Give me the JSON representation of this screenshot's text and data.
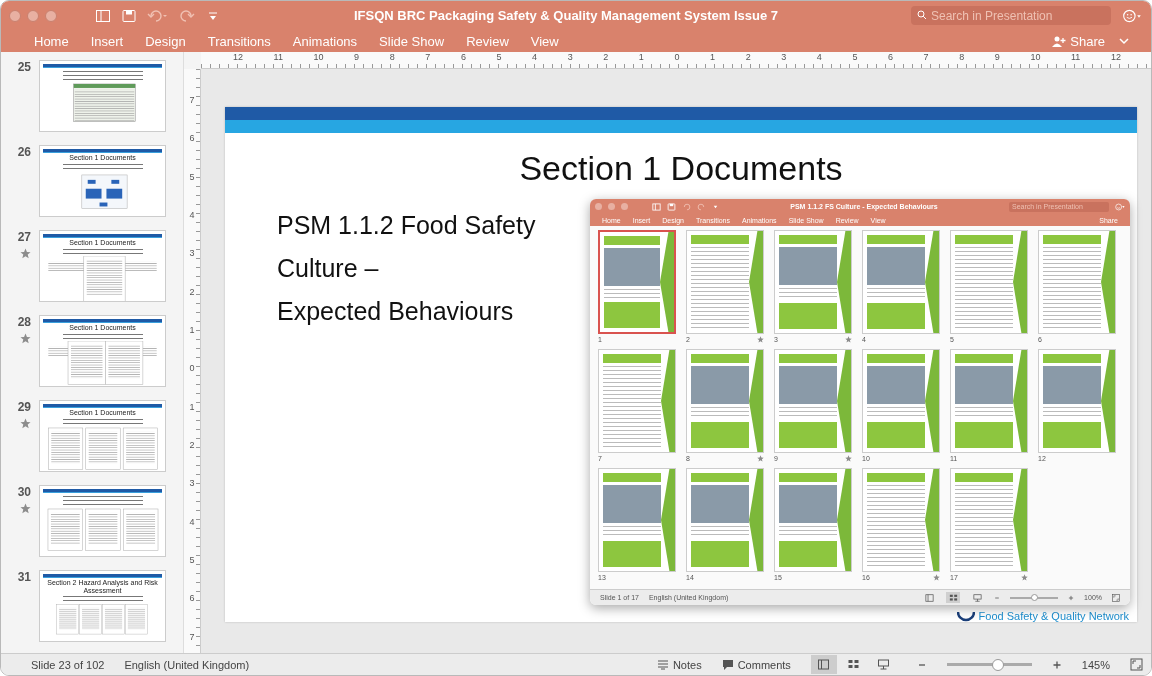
{
  "window": {
    "title": "IFSQN BRC Packaging Safety & Quality Management System Issue 7"
  },
  "search": {
    "placeholder": "Search in Presentation"
  },
  "tabs": [
    {
      "label": "Home"
    },
    {
      "label": "Insert"
    },
    {
      "label": "Design"
    },
    {
      "label": "Transitions"
    },
    {
      "label": "Animations"
    },
    {
      "label": "Slide Show"
    },
    {
      "label": "Review"
    },
    {
      "label": "View"
    }
  ],
  "share": "Share",
  "ruler": {
    "horizontal": [
      "12",
      "11",
      "10",
      "9",
      "8",
      "7",
      "6",
      "5",
      "4",
      "3",
      "2",
      "1",
      "0",
      "1",
      "2",
      "3",
      "4",
      "5",
      "6",
      "7",
      "8",
      "9",
      "10",
      "11",
      "12"
    ],
    "vertical": [
      "7",
      "6",
      "5",
      "4",
      "3",
      "2",
      "1",
      "0",
      "1",
      "2",
      "3",
      "4",
      "5",
      "6",
      "7"
    ]
  },
  "slides": [
    {
      "number": "25",
      "kind": "table",
      "starred": false
    },
    {
      "number": "26",
      "kind": "diagram",
      "starred": false,
      "title": "Section 1 Documents"
    },
    {
      "number": "27",
      "kind": "document",
      "starred": true,
      "title": "Section 1 Documents"
    },
    {
      "number": "28",
      "kind": "two-docs",
      "starred": true,
      "title": "Section 1 Documents"
    },
    {
      "number": "29",
      "kind": "three-docs",
      "starred": true,
      "title": "Section 1 Documents"
    },
    {
      "number": "30",
      "kind": "three-docs",
      "starred": true
    },
    {
      "number": "31",
      "kind": "four-docs",
      "starred": false,
      "title": "Section 2 Hazard Analysis and Risk Assessment"
    }
  ],
  "current_slide": {
    "title": "Section 1 Documents",
    "body": [
      "PSM 1.1.2 Food Safety",
      "Culture –",
      "Expected Behaviours"
    ],
    "logo": "Food Safety & Quality Network"
  },
  "embedded_window": {
    "title": "PSM 1.1.2 FS Culture - Expected Behaviours",
    "search": {
      "placeholder": "Search in Presentation"
    },
    "tabs": [
      {
        "label": "Home"
      },
      {
        "label": "Insert"
      },
      {
        "label": "Design"
      },
      {
        "label": "Transitions"
      },
      {
        "label": "Animations"
      },
      {
        "label": "Slide Show"
      },
      {
        "label": "Review"
      },
      {
        "label": "View"
      }
    ],
    "share": "Share",
    "slides": [
      {
        "number": "1",
        "kind": "photo",
        "selected": true,
        "starred": false
      },
      {
        "number": "2",
        "kind": "text",
        "selected": false,
        "starred": true
      },
      {
        "number": "3",
        "kind": "photo",
        "selected": false,
        "starred": true
      },
      {
        "number": "4",
        "kind": "photo",
        "selected": false,
        "starred": false
      },
      {
        "number": "5",
        "kind": "text",
        "selected": false,
        "starred": false
      },
      {
        "number": "6",
        "kind": "text",
        "selected": false,
        "starred": false
      },
      {
        "number": "7",
        "kind": "text",
        "selected": false,
        "starred": false
      },
      {
        "number": "8",
        "kind": "photo",
        "selected": false,
        "starred": true
      },
      {
        "number": "9",
        "kind": "photo",
        "selected": false,
        "starred": true
      },
      {
        "number": "10",
        "kind": "photo",
        "selected": false,
        "starred": false
      },
      {
        "number": "11",
        "kind": "photo",
        "selected": false,
        "starred": false
      },
      {
        "number": "12",
        "kind": "photo",
        "selected": false,
        "starred": false
      },
      {
        "number": "13",
        "kind": "photo",
        "selected": false,
        "starred": false
      },
      {
        "number": "14",
        "kind": "photo",
        "selected": false,
        "starred": false
      },
      {
        "number": "15",
        "kind": "photo",
        "selected": false,
        "starred": false
      },
      {
        "number": "16",
        "kind": "text",
        "selected": false,
        "starred": true
      },
      {
        "number": "17",
        "kind": "text",
        "selected": false,
        "starred": true
      }
    ],
    "status_bar": {
      "slide": "Slide 1 of 17",
      "language": "English (United Kingdom)",
      "views": [
        {
          "selected": false
        },
        {
          "selected": true
        },
        {
          "selected": false
        }
      ],
      "level": 0.5,
      "zoom": "100%"
    }
  },
  "status_bar": {
    "slide": "Slide 23 of 102",
    "language": "English (United Kingdom)",
    "notes": "Notes",
    "comments": "Comments",
    "views": [
      {
        "selected": true
      },
      {
        "selected": false
      },
      {
        "selected": false
      }
    ],
    "level": 0.6,
    "zoom": "145%"
  }
}
